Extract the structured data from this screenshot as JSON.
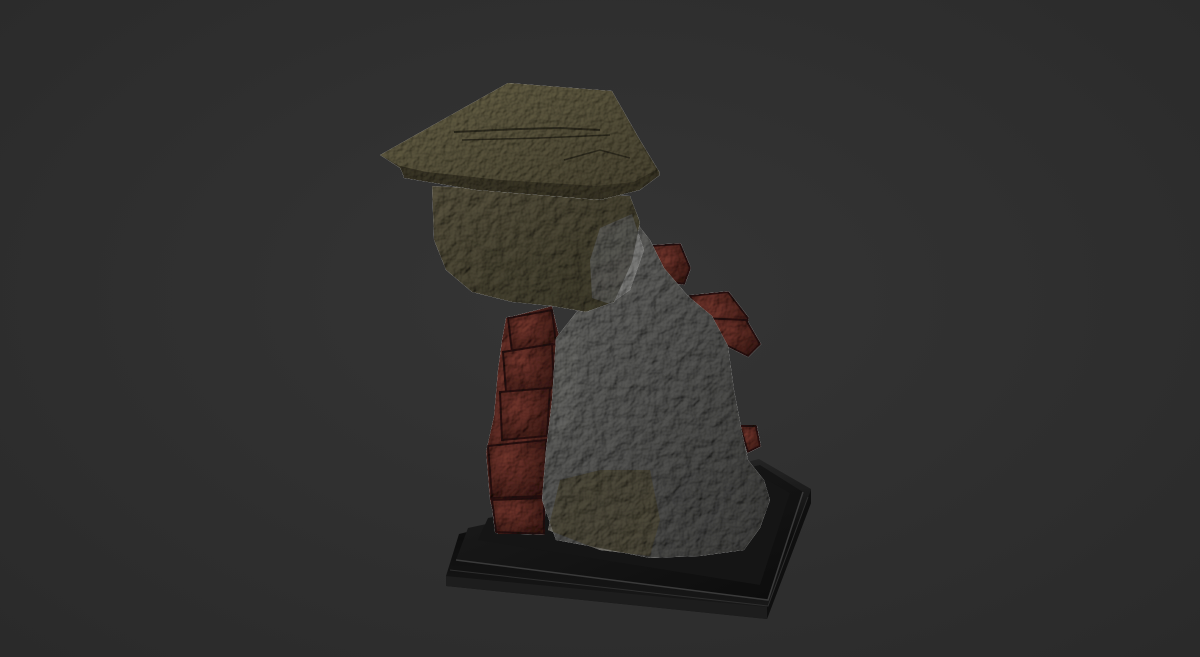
{
  "scene": {
    "background_color": "#2f2f2f",
    "materials": {
      "base": "#111111",
      "capstone": "#55503a",
      "rock": "#5b5b59",
      "brick": "#5e2a22",
      "moss": "#4f4a38"
    }
  }
}
